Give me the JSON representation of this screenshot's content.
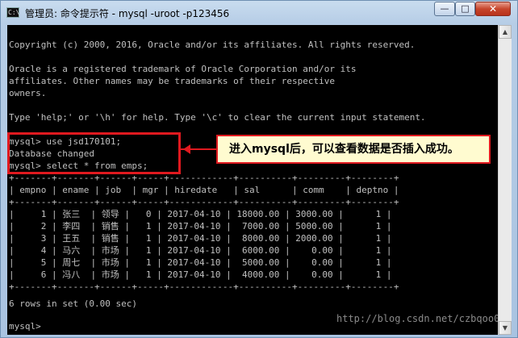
{
  "window": {
    "title": "管理员: 命令提示符 - mysql  -uroot -p123456",
    "icon_text": "C:\\",
    "buttons": {
      "minimize": "—",
      "maximize": "□",
      "close": "✕"
    }
  },
  "console": {
    "lines": [
      "",
      "Copyright (c) 2000, 2016, Oracle and/or its affiliates. All rights reserved.",
      "",
      "Oracle is a registered trademark of Oracle Corporation and/or its",
      "affiliates. Other names may be trademarks of their respective",
      "owners.",
      "",
      "Type 'help;' or '\\h' for help. Type '\\c' to clear the current input statement.",
      "",
      "mysql> use jsd170101;",
      "Database changed",
      "mysql> select * from emps;",
      "+-------+-------+------+-----+------------+----------+---------+--------+",
      "| empno | ename | job  | mgr | hiredate   | sal      | comm    | deptno |",
      "+-------+-------+------+-----+------------+----------+---------+--------+",
      "|     1 | 张三  | 领导 |   0 | 2017-04-10 | 18000.00 | 3000.00 |      1 |",
      "|     2 | 李四  | 销售 |   1 | 2017-04-10 |  7000.00 | 5000.00 |      1 |",
      "|     3 | 王五  | 销售 |   1 | 2017-04-10 |  8000.00 | 2000.00 |      1 |",
      "|     4 | 马六  | 市场 |   1 | 2017-04-10 |  6000.00 |    0.00 |      1 |",
      "|     5 | 周七  | 市场 |   1 | 2017-04-10 |  5000.00 |    0.00 |      1 |",
      "|     6 | 冯八  | 市场 |   1 | 2017-04-10 |  4000.00 |    0.00 |      1 |",
      "+-------+-------+------+-----+------------+----------+---------+--------+",
      "",
      "6 rows in set (0.00 sec)",
      "",
      "mysql>"
    ]
  },
  "annotation": {
    "callout_text": "进入mysql后，可以查看数据是否插入成功。"
  },
  "watermark": "http://blog.csdn.net/czbqoo01",
  "scrollbar": {
    "up_arrow": "▲",
    "down_arrow": "▼"
  },
  "colors": {
    "console_bg": "#000000",
    "console_text": "#c0c0c0",
    "annotation_red": "#e0191f",
    "callout_bg": "#fffbd0"
  }
}
